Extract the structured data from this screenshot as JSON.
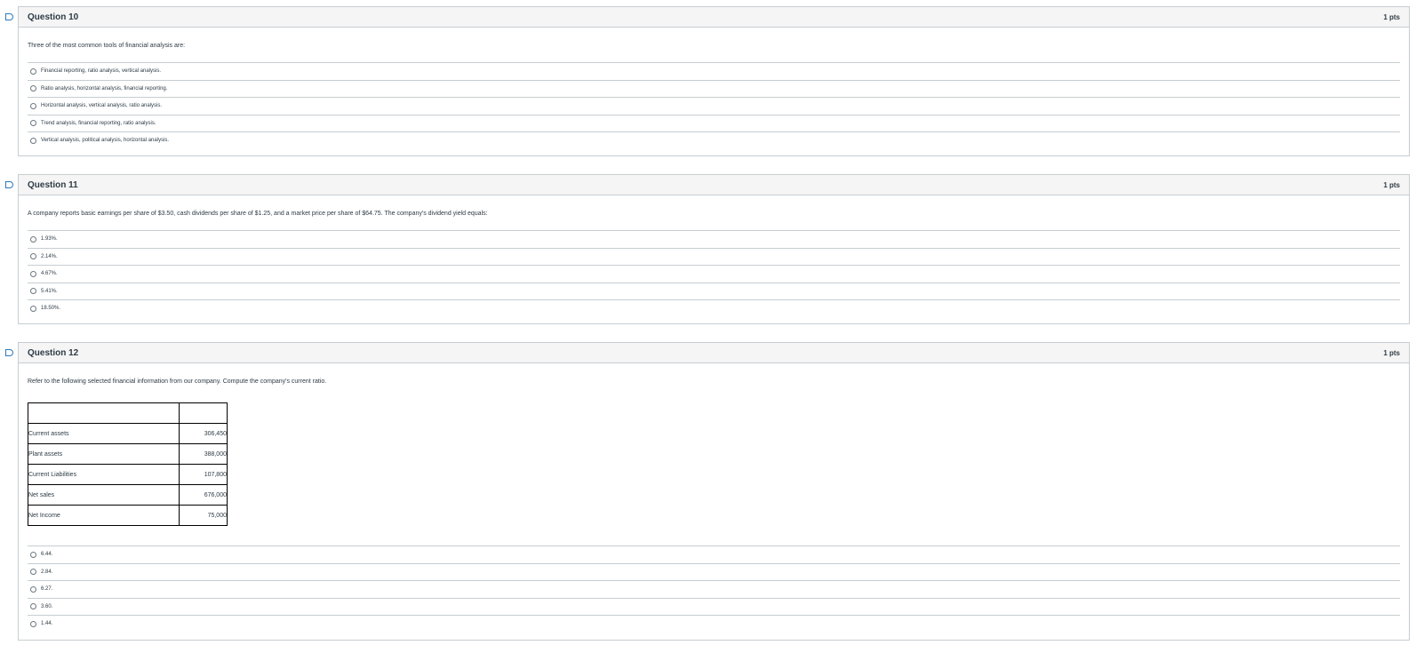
{
  "questions": [
    {
      "title": "Question 10",
      "points": "1 pts",
      "text": "Three of the most common tools of financial analysis are:",
      "answers": [
        "Financial reporting, ratio analysis, vertical analysis.",
        "Ratio analysis, horizontal analysis, financial reporting.",
        "Horizontal analysis, vertical analysis, ratio analysis.",
        "Trend analysis, financial reporting, ratio analysis.",
        "Vertical analysis, political analysis, horizontal analysis."
      ]
    },
    {
      "title": "Question 11",
      "points": "1 pts",
      "text": "A company reports basic earnings per share of $3.50, cash dividends per share of $1.25, and a market price per share of $64.75. The company's dividend yield equals:",
      "answers": [
        "1.93%.",
        "2.14%.",
        "4.67%.",
        "5.41%.",
        "18.50%."
      ]
    },
    {
      "title": "Question 12",
      "points": "1 pts",
      "text": "Refer to the following selected financial information from our company. Compute the company's current ratio.",
      "table": {
        "header": [
          "",
          ""
        ],
        "rows": [
          {
            "label": "Current assets",
            "value": "306,450"
          },
          {
            "label": "Plant assets",
            "value": "388,000"
          },
          {
            "label": "Current Liabilities",
            "value": "107,800"
          },
          {
            "label": "Net sales",
            "value": "676,000"
          },
          {
            "label": "Net Income",
            "value": "75,000"
          }
        ]
      },
      "answers": [
        "6.44.",
        "2.84.",
        "6.27.",
        "3.60.",
        "1.44."
      ]
    }
  ]
}
